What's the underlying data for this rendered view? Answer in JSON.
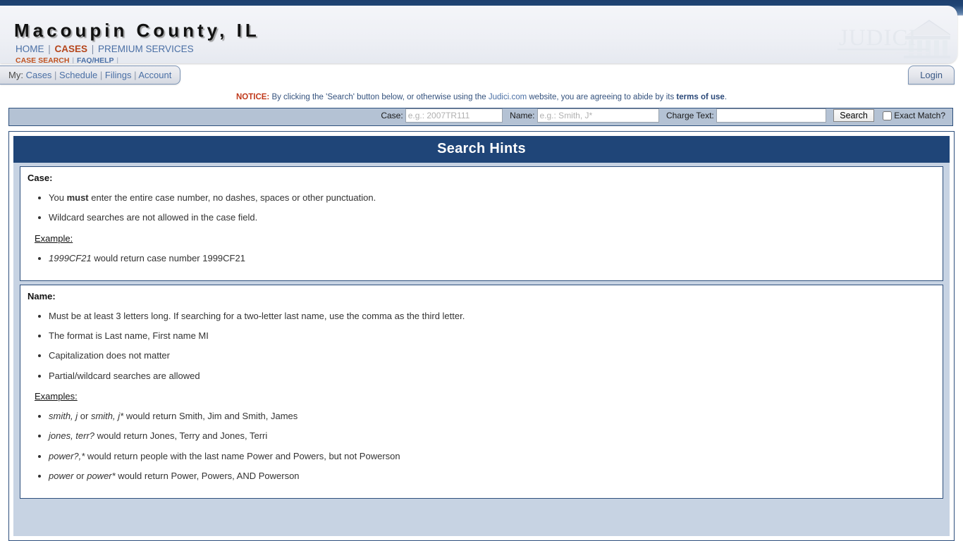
{
  "header": {
    "county_title": "Macoupin County, IL",
    "nav_primary": [
      {
        "label": "HOME",
        "active": false
      },
      {
        "label": "CASES",
        "active": true
      },
      {
        "label": "PREMIUM SERVICES",
        "active": false
      }
    ],
    "nav_secondary": [
      {
        "label": "CASE SEARCH",
        "active": true
      },
      {
        "label": "FAQ/HELP",
        "active": false
      }
    ],
    "logo_text": "JUDICI",
    "logo_icon": "courthouse-icon"
  },
  "mytabs": {
    "lead": "My:",
    "items": [
      "Cases",
      "Schedule",
      "Filings",
      "Account"
    ],
    "login_label": "Login"
  },
  "notice": {
    "label": "NOTICE:",
    "text_before_link": " By clicking the 'Search' button below, or otherwise using the ",
    "site_link": "Judici.com",
    "text_middle": " website, you are agreeing to abide by its ",
    "terms_link": "terms of use",
    "text_end": "."
  },
  "search": {
    "case_label": "Case:",
    "case_value": "",
    "case_placeholder": "e.g.: 2007TR111",
    "name_label": "Name:",
    "name_value": "",
    "name_placeholder": "e.g.: Smith, J*",
    "charge_label": "Charge Text:",
    "charge_value": "",
    "charge_placeholder": "",
    "search_button": "Search",
    "exact_match_label": "Exact Match?",
    "exact_match_checked": false
  },
  "hints": {
    "title": "Search Hints",
    "case_section": {
      "heading": "Case:",
      "bullets": [
        "You must enter the entire case number, no dashes, spaces or other punctuation.",
        "Wildcard searches are not allowed in the case field."
      ],
      "example_label": "Example:",
      "examples": [
        "1999CF21 would return case number 1999CF21"
      ]
    },
    "name_section": {
      "heading": "Name:",
      "bullets": [
        "Must be at least 3 letters long. If searching for a two-letter last name, use the comma as the third letter.",
        "The format is Last name, First name MI",
        "Capitalization does not matter",
        "Partial/wildcard searches are allowed"
      ],
      "example_label": "Examples:",
      "examples": [
        "smith, j or smith, j* would return Smith, Jim and Smith, James",
        "jones, terr? would return Jones, Terry and Jones, Terri",
        "power?,* would return people with the last name Power and Powers, but not Powerson",
        "power or power* would return Power, Powers, AND Powerson"
      ]
    }
  },
  "colors": {
    "navy": "#1f4578",
    "accent_orange": "#b5451b",
    "link_blue": "#4a6fa5",
    "notice_red": "#c0391b",
    "searchbar_bg": "#b4c2d4",
    "gutter_blue": "#c7d3e3"
  }
}
